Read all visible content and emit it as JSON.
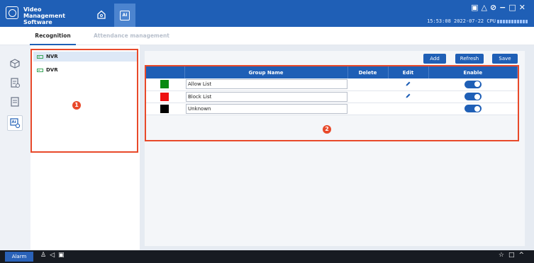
{
  "app": {
    "title": "Video Management Software",
    "status_time": "15:53:08 2022-07-22 CPU"
  },
  "window_controls": [
    "▣",
    "△",
    "⊘",
    "−",
    "□",
    "✕"
  ],
  "tabs": [
    {
      "label": "Recognition",
      "active": true
    },
    {
      "label": "Attendance management",
      "active": false
    }
  ],
  "side_icons": [
    "face-library-icon",
    "face-record-icon",
    "list-icon",
    "ai-settings-icon"
  ],
  "devices": [
    {
      "label": "NVR",
      "selected": true
    },
    {
      "label": "DVR",
      "selected": false
    }
  ],
  "toolbar": {
    "add_label": "Add",
    "refresh_label": "Refresh",
    "save_label": "Save"
  },
  "table": {
    "headers": [
      "",
      "Group Name",
      "Delete",
      "Edit",
      "Enable"
    ],
    "rows": [
      {
        "color": "#0a8a12",
        "name": "Allow List",
        "editable": true,
        "enabled": true
      },
      {
        "color": "#ee1111",
        "name": "Block List",
        "editable": true,
        "enabled": true
      },
      {
        "color": "#000000",
        "name": "Unknown",
        "editable": false,
        "enabled": true
      }
    ]
  },
  "annotations": [
    "1",
    "2"
  ],
  "footer": {
    "alarm_label": "Alarm",
    "left_icons": [
      "♙",
      "◁",
      "▣"
    ],
    "right_icons": [
      "☆",
      "□",
      "^"
    ]
  },
  "colors": {
    "brand": "#1f5fb6",
    "annotation": "#e8492a"
  }
}
